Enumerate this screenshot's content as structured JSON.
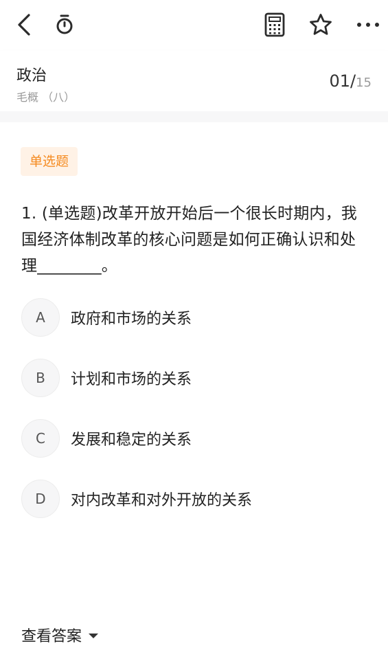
{
  "toolbar": {
    "back_icon": "chevron-left",
    "timer_icon": "stopwatch",
    "calculator_icon": "calculator",
    "favorite_icon": "star-outline",
    "more_icon": "ellipsis-horizontal"
  },
  "header": {
    "subject": "政治",
    "chapter": "毛概 （八）",
    "current": "01/",
    "total": "15"
  },
  "question": {
    "type_badge": "单选题",
    "text": "1. (单选题)改革开放开始后一个很长时期内，我国经济体制改革的核心问题是如何正确认识和处理________。"
  },
  "options": [
    {
      "letter": "A",
      "text": "政府和市场的关系"
    },
    {
      "letter": "B",
      "text": "计划和市场的关系"
    },
    {
      "letter": "C",
      "text": "发展和稳定的关系"
    },
    {
      "letter": "D",
      "text": "对内改革和对外开放的关系"
    }
  ],
  "footer": {
    "view_answer_label": "查看答案"
  },
  "colors": {
    "accent": "#f58a1f",
    "badge_bg": "#fff2e6",
    "muted_text": "#9a9a9a"
  }
}
